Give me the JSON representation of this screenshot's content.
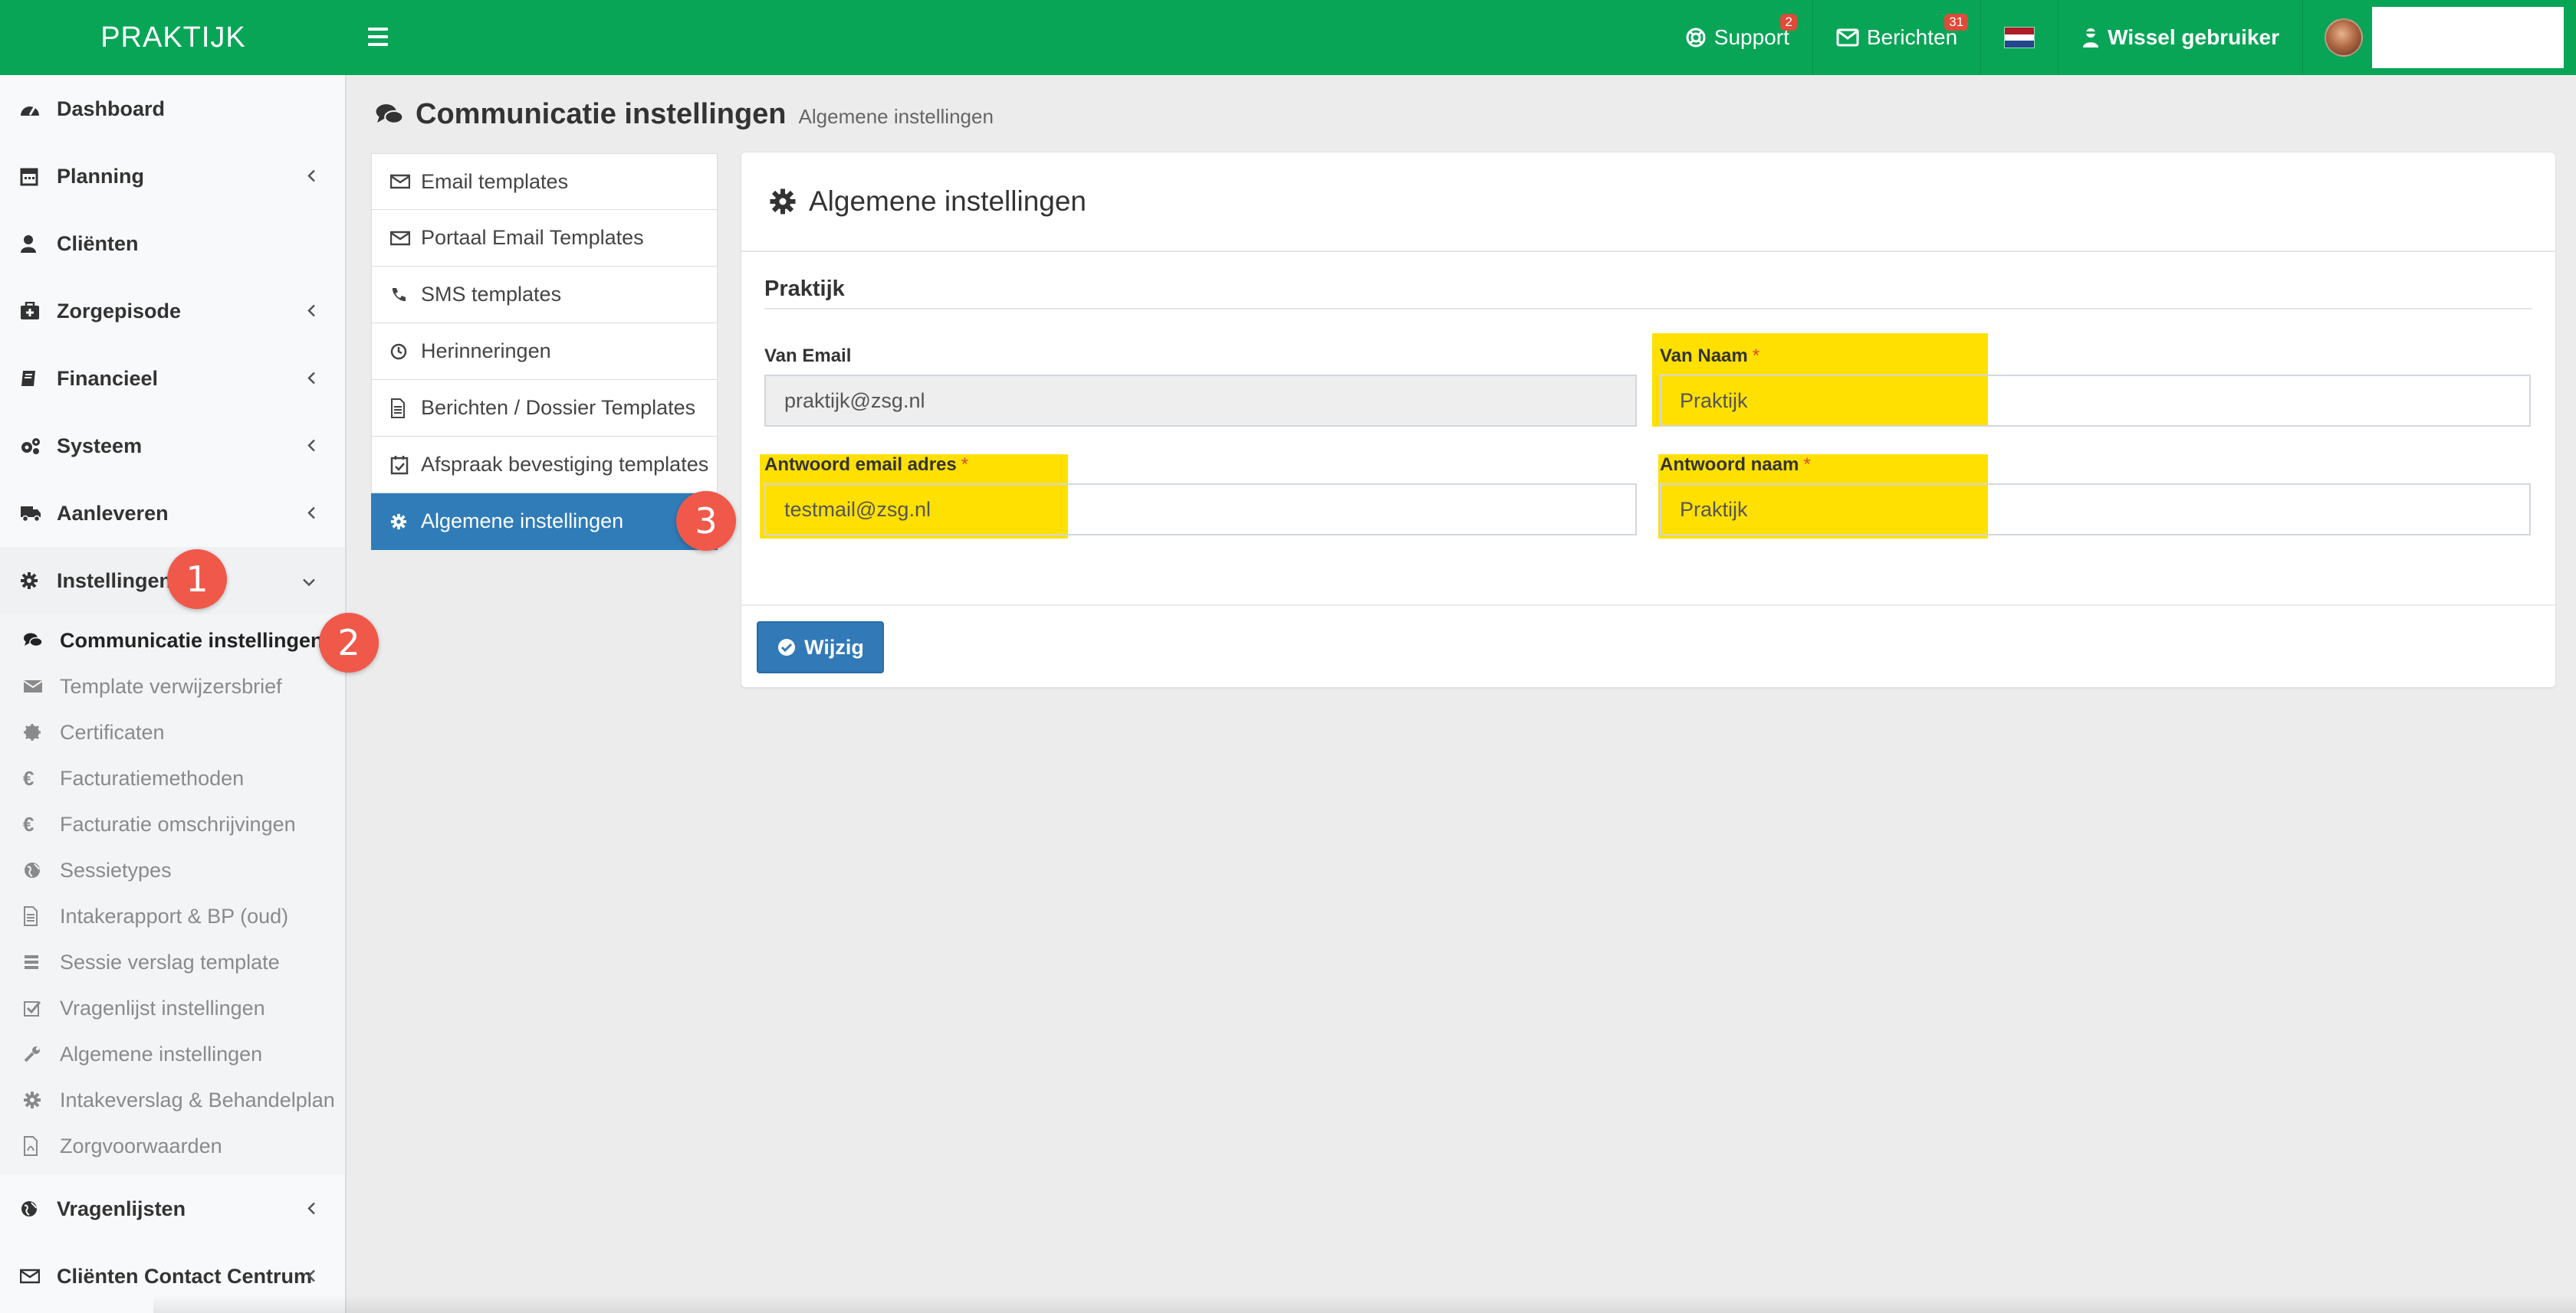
{
  "app": {
    "logo": "PRAKTIJK"
  },
  "topbar": {
    "support_label": "Support",
    "support_badge": "2",
    "messages_label": "Berichten",
    "messages_badge": "31",
    "switch_user_label": "Wissel gebruiker",
    "flag_colors": [
      "#ae1c28",
      "#ffffff",
      "#21468b"
    ]
  },
  "sidebar": {
    "items": [
      {
        "label": "Dashboard",
        "icon": "dashboard-icon"
      },
      {
        "label": "Planning",
        "icon": "calendar-icon"
      },
      {
        "label": "Cliënten",
        "icon": "user-icon"
      },
      {
        "label": "Zorgepisode",
        "icon": "medkit-icon"
      },
      {
        "label": "Financieel",
        "icon": "book-icon"
      },
      {
        "label": "Systeem",
        "icon": "cogs-icon"
      },
      {
        "label": "Aanleveren",
        "icon": "truck-icon"
      },
      {
        "label": "Instellingen",
        "icon": "gear-icon"
      },
      {
        "label": "Vragenlijsten",
        "icon": "globe-icon"
      },
      {
        "label": "Cliënten Contact Centrum",
        "icon": "envelope-icon"
      }
    ],
    "submenu": [
      {
        "label": "Communicatie instellingen",
        "icon": "comments-icon"
      },
      {
        "label": "Template verwijzersbrief",
        "icon": "envelope-icon"
      },
      {
        "label": "Certificaten",
        "icon": "certificate-icon"
      },
      {
        "label": "Facturatiemethoden",
        "icon": "euro-icon"
      },
      {
        "label": "Facturatie omschrijvingen",
        "icon": "euro-icon"
      },
      {
        "label": "Sessietypes",
        "icon": "globe-icon"
      },
      {
        "label": "Intakerapport & BP (oud)",
        "icon": "file-icon"
      },
      {
        "label": "Sessie verslag template",
        "icon": "list-icon"
      },
      {
        "label": "Vragenlijst instellingen",
        "icon": "check-square-icon"
      },
      {
        "label": "Algemene instellingen",
        "icon": "wrench-icon"
      },
      {
        "label": "Intakeverslag & Behandelplan",
        "icon": "gear-icon"
      },
      {
        "label": "Zorgvoorwaarden",
        "icon": "pdf-icon"
      }
    ]
  },
  "steps": [
    "1",
    "2",
    "3"
  ],
  "page": {
    "title": "Communicatie instellingen",
    "subtitle": "Algemene instellingen"
  },
  "tabs": [
    {
      "label": "Email templates",
      "icon": "envelope-icon"
    },
    {
      "label": "Portaal Email Templates",
      "icon": "envelope-icon"
    },
    {
      "label": "SMS templates",
      "icon": "phone-icon"
    },
    {
      "label": "Herinneringen",
      "icon": "clock-icon"
    },
    {
      "label": "Berichten / Dossier Templates",
      "icon": "file-icon"
    },
    {
      "label": "Afspraak bevestiging templates",
      "icon": "calendar-check-icon"
    },
    {
      "label": "Algemene instellingen",
      "icon": "gear-icon"
    }
  ],
  "panel": {
    "title": "Algemene instellingen",
    "section": "Praktijk",
    "fields": {
      "van_email": {
        "label": "Van Email",
        "value": "praktijk@zsg.nl"
      },
      "van_naam": {
        "label": "Van Naam",
        "required": "*",
        "value": "Praktijk"
      },
      "antwoord_email": {
        "label": "Antwoord email adres",
        "required": "*",
        "value": "testmail@zsg.nl"
      },
      "antwoord_naam": {
        "label": "Antwoord naam",
        "required": "*",
        "value": "Praktijk"
      }
    },
    "submit_label": "Wijzig"
  },
  "colors": {
    "topbar": "#08a557",
    "active_tab": "#2f7cb8",
    "highlight": "#ffe000",
    "step_badge": "#f0584a"
  }
}
